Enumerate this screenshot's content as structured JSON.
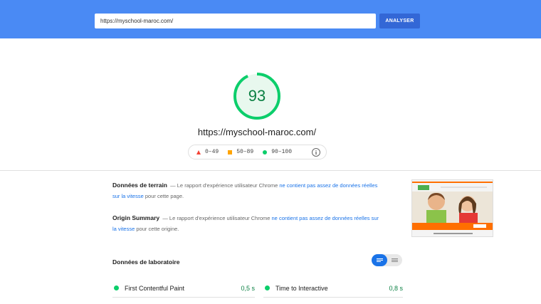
{
  "search": {
    "url_value": "https://myschool-maroc.com/",
    "button_label": "ANALYSER"
  },
  "score": {
    "value": "93",
    "fraction": 0.93,
    "color": "#0cce6b"
  },
  "tested_url": "https://myschool-maroc.com/",
  "legend": [
    {
      "shape": "triangle",
      "color": "#f44336",
      "label": "0–49"
    },
    {
      "shape": "square",
      "color": "#ffa400",
      "label": "50–89"
    },
    {
      "shape": "circle",
      "color": "#0cce6b",
      "label": "90–100"
    }
  ],
  "field_data": {
    "title": "Données de terrain",
    "dash": "—",
    "text_before": "Le rapport d'expérience utilisateur Chrome",
    "link": "ne contient pas assez de données réelles sur la vitesse",
    "text_after": "pour cette page."
  },
  "origin_summary": {
    "title": "Origin Summary",
    "dash": "—",
    "text_before": "Le rapport d'expérience utilisateur Chrome",
    "link": "ne contient pas assez de données réelles sur la vitesse",
    "text_after": "pour cette origine."
  },
  "lab_data": {
    "title": "Données de laboratoire",
    "metrics": [
      {
        "label": "First Contentful Paint",
        "value": "0,5 s"
      },
      {
        "label": "Time to Interactive",
        "value": "0,8 s"
      }
    ]
  },
  "colors": {
    "header_bg": "#4a8af4",
    "button_bg": "#3367d6",
    "pass": "#0cce6b",
    "link": "#1a73e8"
  }
}
